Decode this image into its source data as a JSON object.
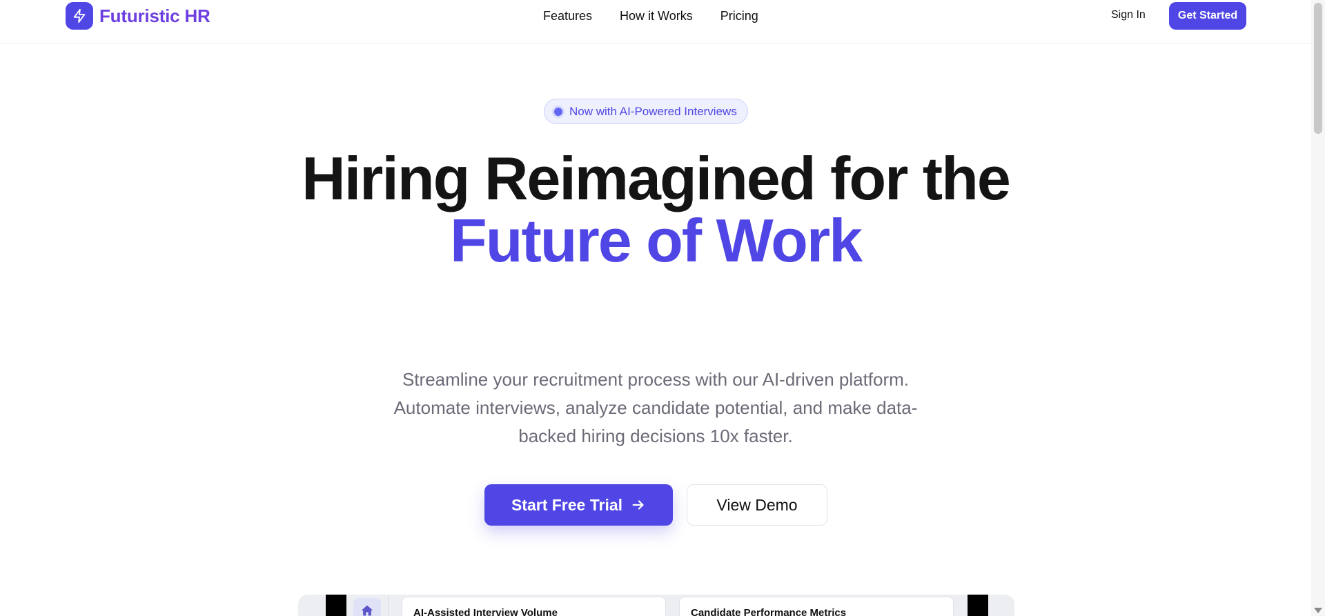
{
  "nav": {
    "brand": "Futuristic HR",
    "links": [
      "Features",
      "How it Works",
      "Pricing"
    ],
    "sign_in": "Sign In",
    "get_started": "Get Started"
  },
  "hero": {
    "badge": "Now with AI-Powered Interviews",
    "title_line1": "Hiring Reimagined for the",
    "title_accent": "Future of Work",
    "subtitle": "Streamline your recruitment process with our AI-driven platform. Automate interviews, analyze candidate potential, and make data-backed hiring decisions 10x faster.",
    "primary_cta": "Start Free Trial",
    "secondary_cta": "View Demo"
  },
  "preview": {
    "cards": [
      "AI-Assisted Interview Volume",
      "Candidate Performance Metrics"
    ]
  },
  "colors": {
    "primary": "#4f46e5",
    "brand_text": "#6d3fe0",
    "muted_text": "#6b6b78"
  }
}
